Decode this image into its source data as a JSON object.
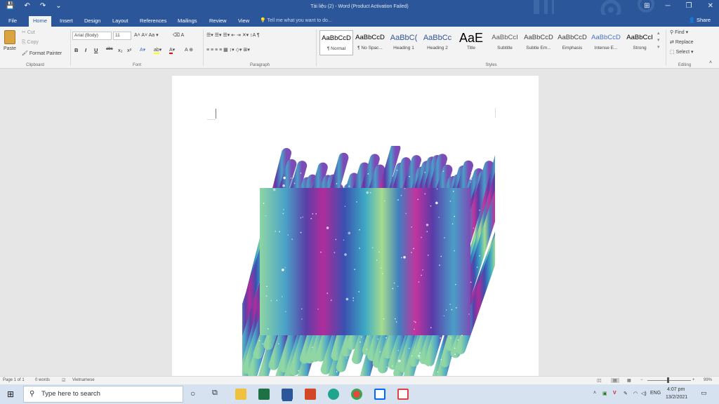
{
  "window": {
    "title": "Tài liệu (2) - Word (Product Activation Failed)",
    "qat": [
      "💾",
      "↶",
      "↷",
      "⌄"
    ],
    "controls": [
      "⊞",
      "─",
      "❐",
      "✕"
    ]
  },
  "tabs": {
    "items": [
      "File",
      "Home",
      "Insert",
      "Design",
      "Layout",
      "References",
      "Mailings",
      "Review",
      "View"
    ],
    "active": "Home",
    "tellme": "Tell me what you want to do...",
    "share": "Share"
  },
  "ribbon": {
    "clipboard": {
      "label": "Clipboard",
      "paste": "Paste",
      "cut": "Cut",
      "copy": "Copy",
      "format_painter": "Format Painter"
    },
    "font": {
      "label": "Font",
      "name": "Arial (Body)",
      "size": "11",
      "buttons": [
        "B",
        "I",
        "U",
        "abc",
        "x₂",
        "x²"
      ]
    },
    "paragraph": {
      "label": "Paragraph"
    },
    "styles": {
      "label": "Styles",
      "items": [
        {
          "sample": "AaBbCcD",
          "name": "¶ Normal",
          "color": "#000000"
        },
        {
          "sample": "AaBbCcD",
          "name": "¶ No Spac...",
          "color": "#000000"
        },
        {
          "sample": "AaBbC(",
          "name": "Heading 1",
          "color": "#2f5496"
        },
        {
          "sample": "AaBbCc",
          "name": "Heading 2",
          "color": "#2f5496"
        },
        {
          "sample": "AaE",
          "name": "Title",
          "color": "#000000"
        },
        {
          "sample": "AaBbCcI",
          "name": "Subtitle",
          "color": "#595959"
        },
        {
          "sample": "AaBbCcD",
          "name": "Subtle Em...",
          "color": "#404040"
        },
        {
          "sample": "AaBbCcD",
          "name": "Emphasis",
          "color": "#404040"
        },
        {
          "sample": "AaBbCcD",
          "name": "Intense E...",
          "color": "#4472c4"
        },
        {
          "sample": "AaBbCcI",
          "name": "Strong",
          "color": "#000000"
        }
      ]
    },
    "editing": {
      "label": "Editing",
      "find": "Find",
      "replace": "Replace",
      "select": "Select"
    }
  },
  "statusbar": {
    "page": "Page 1 of 1",
    "words": "0 words",
    "language": "Vietnamese",
    "zoom": "99%"
  },
  "taskbar": {
    "search_placeholder": "Type here to search",
    "lang": "ENG",
    "time": "4:07 pm",
    "date": "13/2/2021"
  },
  "colors": {
    "accent": "#2b579a",
    "ribbon_bg": "#f3f3f3",
    "doc_bg": "#e6e6e6"
  }
}
